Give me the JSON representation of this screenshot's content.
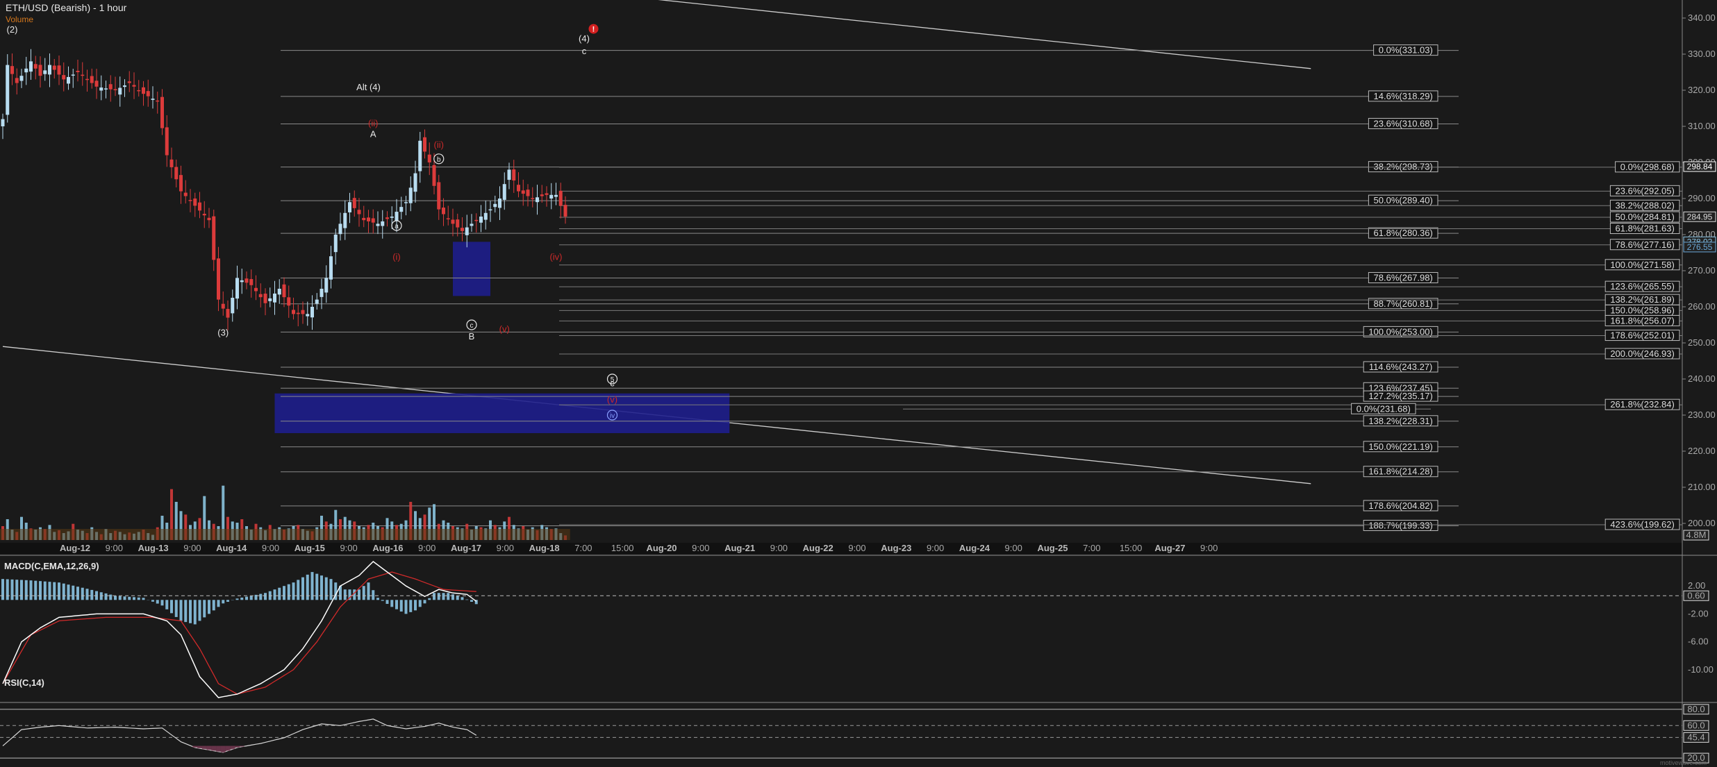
{
  "chart_data": {
    "type": "line",
    "title": "ETH/USD (Bearish) - 1 hour",
    "volume_label": "Volume",
    "volume_axis_label": "4.8M",
    "macd_title": "MACD(C,EMA,12,26,9)",
    "rsi_title": "RSI(C,14)",
    "watermark": "motivewave.com",
    "price_axis": {
      "range": [
        195,
        345
      ],
      "ticks": [
        200,
        210,
        220,
        230,
        240,
        250,
        260,
        270,
        280,
        290,
        300,
        310,
        320,
        330,
        340
      ]
    },
    "price_badges": [
      {
        "value": 298.84,
        "label": "298.84",
        "color": "#ffffff"
      },
      {
        "value": 284.95,
        "label": "284.95",
        "color": "#dddddd"
      },
      {
        "value": 278.02,
        "label": "278.02",
        "color": "#8ac6e8"
      },
      {
        "value": 276.55,
        "label": "276.55",
        "color": "#6aa8d8"
      }
    ],
    "macd_axis": {
      "range": [
        -14,
        6
      ],
      "ticks": [
        2.0,
        -2.0,
        -6.0,
        -10.0
      ],
      "tick_labels": [
        "2.00",
        "-2.00",
        "-6.00",
        "-10.00"
      ],
      "badge": "0.60",
      "badge_value": 0.6
    },
    "rsi_axis": {
      "range": [
        15,
        85
      ],
      "ticks": [
        80.0,
        60.0,
        45.4,
        20.0
      ],
      "tick_labels": [
        "80.0",
        "60.0",
        "45.4",
        "20.0"
      ],
      "dashed_levels": [
        60,
        45.4
      ]
    },
    "time_axis": {
      "labels": [
        "Aug-12",
        "9:00",
        "Aug-13",
        "9:00",
        "Aug-14",
        "9:00",
        "Aug-15",
        "9:00",
        "Aug-16",
        "9:00",
        "Aug-17",
        "9:00",
        "Aug-18",
        "7:00",
        "15:00",
        "Aug-20",
        "9:00",
        "Aug-21",
        "9:00",
        "Aug-22",
        "9:00",
        "Aug-23",
        "9:00",
        "Aug-24",
        "9:00",
        "Aug-25",
        "7:00",
        "15:00",
        "Aug-27",
        "9:00"
      ],
      "bold": [
        "Aug-12",
        "Aug-13",
        "Aug-14",
        "Aug-15",
        "Aug-16",
        "Aug-17",
        "Aug-18",
        "Aug-20",
        "Aug-21",
        "Aug-22",
        "Aug-23",
        "Aug-24",
        "Aug-25",
        "Aug-27"
      ]
    },
    "price_series": {
      "name": "ETH/USD",
      "anchors": [
        [
          0,
          312
        ],
        [
          1,
          327
        ],
        [
          3,
          322
        ],
        [
          6,
          328
        ],
        [
          8,
          324
        ],
        [
          10,
          327
        ],
        [
          13,
          323
        ],
        [
          16,
          325
        ],
        [
          20,
          321
        ],
        [
          24,
          320
        ],
        [
          27,
          322
        ],
        [
          30,
          319
        ],
        [
          33,
          317
        ],
        [
          35,
          302
        ],
        [
          38,
          292
        ],
        [
          41,
          288
        ],
        [
          44,
          284
        ],
        [
          46,
          262
        ],
        [
          48,
          257
        ],
        [
          50,
          268
        ],
        [
          53,
          266
        ],
        [
          56,
          261
        ],
        [
          59,
          265
        ],
        [
          62,
          258
        ],
        [
          65,
          258
        ],
        [
          67,
          262
        ],
        [
          69,
          268
        ],
        [
          71,
          280
        ],
        [
          74,
          289
        ],
        [
          77,
          284
        ],
        [
          80,
          283
        ],
        [
          83,
          285
        ],
        [
          86,
          289
        ],
        [
          88,
          297
        ],
        [
          89,
          306
        ],
        [
          91,
          300
        ],
        [
          93,
          287
        ],
        [
          96,
          283
        ],
        [
          98,
          281
        ],
        [
          101,
          284
        ],
        [
          104,
          287
        ],
        [
          106,
          290
        ],
        [
          108,
          298
        ],
        [
          110,
          292
        ],
        [
          113,
          290
        ],
        [
          116,
          291
        ],
        [
          118,
          291
        ],
        [
          120,
          285
        ]
      ]
    },
    "volume": [
      120,
      180,
      90,
      70,
      200,
      150,
      100,
      90,
      110,
      95,
      130,
      70,
      85,
      60,
      75,
      140,
      90,
      80,
      60,
      110,
      70,
      50,
      95,
      60,
      80,
      70,
      50,
      65,
      55,
      70,
      90,
      60,
      45,
      110,
      210,
      150,
      440,
      330,
      250,
      220,
      130,
      160,
      190,
      380,
      170,
      140,
      120,
      470,
      200,
      160,
      150,
      180,
      120,
      90,
      140,
      110,
      85,
      130,
      95,
      110,
      90,
      100,
      120,
      130,
      95,
      80,
      75,
      110,
      210,
      160,
      140,
      260,
      180,
      200,
      170,
      160,
      120,
      110,
      130,
      150,
      120,
      110,
      190,
      160,
      130,
      140,
      170,
      330,
      250,
      190,
      220,
      280,
      310,
      140,
      170,
      150,
      120,
      110,
      100,
      140,
      90,
      120,
      110,
      100,
      170,
      130,
      110,
      160,
      200,
      130,
      100,
      120,
      90,
      110,
      85,
      130,
      110,
      95,
      100,
      60,
      40
    ],
    "fib_left": [
      {
        "label": "0.0%(331.03)",
        "value": 331.03
      },
      {
        "label": "14.6%(318.29)",
        "value": 318.29
      },
      {
        "label": "23.6%(310.68)",
        "value": 310.68
      },
      {
        "label": "38.2%(298.73)",
        "value": 298.73
      },
      {
        "label": "50.0%(289.40)",
        "value": 289.4
      },
      {
        "label": "61.8%(280.36)",
        "value": 280.36
      },
      {
        "label": "78.6%(267.98)",
        "value": 267.98
      },
      {
        "label": "88.7%(260.81)",
        "value": 260.81
      },
      {
        "label": "100.0%(253.00)",
        "value": 253.0
      },
      {
        "label": "114.6%(243.27)",
        "value": 243.27
      },
      {
        "label": "123.6%(237.45)",
        "value": 237.45
      },
      {
        "label": "127.2%(235.17)",
        "value": 235.17
      },
      {
        "label": "138.2%(228.31)",
        "value": 228.31
      },
      {
        "label": "150.0%(221.19)",
        "value": 221.19
      },
      {
        "label": "161.8%(214.28)",
        "value": 214.28
      },
      {
        "label": "178.6%(204.82)",
        "value": 204.82
      },
      {
        "label": "188.7%(199.33)",
        "value": 199.33
      }
    ],
    "fib_right": [
      {
        "label": "0.0%(298.68)",
        "value": 298.68
      },
      {
        "label": "23.6%(292.05)",
        "value": 292.05
      },
      {
        "label": "38.2%(288.02)",
        "value": 288.02
      },
      {
        "label": "50.0%(284.81)",
        "value": 284.81
      },
      {
        "label": "61.8%(281.63)",
        "value": 281.63
      },
      {
        "label": "78.6%(277.16)",
        "value": 277.16
      },
      {
        "label": "100.0%(271.58)",
        "value": 271.58
      },
      {
        "label": "123.6%(265.55)",
        "value": 265.55
      },
      {
        "label": "138.2%(261.89)",
        "value": 261.89
      },
      {
        "label": "150.0%(258.96)",
        "value": 258.96
      },
      {
        "label": "161.8%(256.07)",
        "value": 256.07
      },
      {
        "label": "178.6%(252.01)",
        "value": 252.01
      },
      {
        "label": "200.0%(246.93)",
        "value": 246.93
      },
      {
        "label": "261.8%(232.84)",
        "value": 232.84
      },
      {
        "label": "423.6%(199.62)",
        "value": 199.62
      }
    ],
    "fib_mid": {
      "label": "0.0%(231.68)",
      "value": 231.68
    },
    "wave_labels": [
      {
        "text": "(2)",
        "bar": 2,
        "price": 336,
        "color": "white"
      },
      {
        "text": "(3)",
        "bar": 47,
        "price": 252,
        "color": "white"
      },
      {
        "text": "Alt (4)",
        "bar": 78,
        "price": 320,
        "color": "white"
      },
      {
        "text": "A",
        "bar": 79,
        "price": 307,
        "color": "white"
      },
      {
        "text": "(4)",
        "bar": 124,
        "price": 333.5,
        "color": "white"
      },
      {
        "text": "c",
        "bar": 124,
        "price": 330,
        "color": "white"
      },
      {
        "text": "B",
        "bar": 100,
        "price": 251,
        "color": "white"
      },
      {
        "text": "c",
        "bar": 130,
        "price": 238,
        "color": "white"
      },
      {
        "text": "(i)",
        "bar": 84,
        "price": 273,
        "color": "red"
      },
      {
        "text": "(ii)",
        "bar": 79,
        "price": 310,
        "color": "red"
      },
      {
        "text": "(ii)",
        "bar": 93,
        "price": 304,
        "color": "red"
      },
      {
        "text": "(iv)",
        "bar": 118,
        "price": 273,
        "color": "red"
      },
      {
        "text": "(v)",
        "bar": 107,
        "price": 253,
        "color": "red"
      },
      {
        "text": "(v)",
        "bar": 130,
        "price": 233.5,
        "color": "red"
      }
    ],
    "circled_labels": [
      {
        "text": "a",
        "bar": 84,
        "price": 282.5,
        "color": "white"
      },
      {
        "text": "b",
        "bar": 93,
        "price": 301,
        "color": "white"
      },
      {
        "text": "c",
        "bar": 100,
        "price": 255,
        "color": "white"
      },
      {
        "text": "5",
        "bar": 130,
        "price": 240,
        "color": "white"
      },
      {
        "text": "iv",
        "bar": 130,
        "price": 230,
        "color": "#8aa0ff"
      }
    ],
    "alert_marker": {
      "bar": 126,
      "price": 337
    },
    "target_boxes": [
      {
        "bar_start": 96,
        "bar_end": 104,
        "price_top": 278,
        "price_bottom": 263
      },
      {
        "bar_start": 58,
        "bar_end": 155,
        "price_top": 236,
        "price_bottom": 225
      }
    ],
    "trendlines": [
      {
        "from": [
          137,
          345.5
        ],
        "to": [
          279,
          326
        ]
      },
      {
        "from": [
          0,
          249
        ],
        "to": [
          279,
          211
        ]
      }
    ],
    "macd": {
      "macd_anchors": [
        [
          0,
          -12
        ],
        [
          4,
          -6
        ],
        [
          8,
          -4
        ],
        [
          12,
          -2.5
        ],
        [
          20,
          -2
        ],
        [
          30,
          -2
        ],
        [
          35,
          -3
        ],
        [
          38,
          -5
        ],
        [
          42,
          -11
        ],
        [
          46,
          -14
        ],
        [
          50,
          -13.5
        ],
        [
          55,
          -12
        ],
        [
          60,
          -10
        ],
        [
          64,
          -7
        ],
        [
          68,
          -3
        ],
        [
          72,
          2
        ],
        [
          76,
          3.5
        ],
        [
          79,
          5.5
        ],
        [
          82,
          4
        ],
        [
          86,
          2
        ],
        [
          90,
          0.5
        ],
        [
          93,
          1.5
        ],
        [
          96,
          1
        ],
        [
          99,
          0.8
        ],
        [
          101,
          -0.2
        ]
      ],
      "signal_anchors": [
        [
          0,
          -12
        ],
        [
          6,
          -5
        ],
        [
          12,
          -3
        ],
        [
          22,
          -2.5
        ],
        [
          32,
          -2.5
        ],
        [
          38,
          -3
        ],
        [
          42,
          -7
        ],
        [
          46,
          -12
        ],
        [
          50,
          -13.5
        ],
        [
          56,
          -12.5
        ],
        [
          62,
          -10
        ],
        [
          67,
          -6
        ],
        [
          72,
          -1
        ],
        [
          78,
          3
        ],
        [
          83,
          4
        ],
        [
          88,
          3
        ],
        [
          94,
          1.5
        ],
        [
          101,
          1.2
        ]
      ],
      "hist_anchors": [
        [
          0,
          3
        ],
        [
          6,
          2.8
        ],
        [
          12,
          2.5
        ],
        [
          18,
          1.6
        ],
        [
          24,
          0.6
        ],
        [
          30,
          0.3
        ],
        [
          34,
          -0.8
        ],
        [
          38,
          -3
        ],
        [
          41,
          -3.5
        ],
        [
          44,
          -2
        ],
        [
          47,
          -0.5
        ],
        [
          50,
          0.2
        ],
        [
          56,
          1
        ],
        [
          62,
          2.5
        ],
        [
          66,
          4
        ],
        [
          70,
          3
        ],
        [
          73,
          1.5
        ],
        [
          76,
          1.5
        ],
        [
          78,
          2.5
        ],
        [
          80,
          0.3
        ],
        [
          83,
          -1
        ],
        [
          86,
          -2
        ],
        [
          88,
          -1.5
        ],
        [
          90,
          -0.5
        ],
        [
          92,
          1
        ],
        [
          95,
          1
        ],
        [
          98,
          0.4
        ],
        [
          101,
          -0.6
        ]
      ]
    },
    "rsi": {
      "anchors": [
        [
          0,
          35
        ],
        [
          4,
          55
        ],
        [
          8,
          58
        ],
        [
          12,
          60
        ],
        [
          18,
          57
        ],
        [
          24,
          58
        ],
        [
          30,
          56
        ],
        [
          34,
          57
        ],
        [
          38,
          40
        ],
        [
          41,
          33
        ],
        [
          44,
          30
        ],
        [
          47,
          27
        ],
        [
          50,
          33
        ],
        [
          55,
          38
        ],
        [
          60,
          45
        ],
        [
          64,
          55
        ],
        [
          68,
          62
        ],
        [
          72,
          60
        ],
        [
          76,
          65
        ],
        [
          79,
          68
        ],
        [
          82,
          60
        ],
        [
          86,
          56
        ],
        [
          90,
          59
        ],
        [
          93,
          63
        ],
        [
          96,
          58
        ],
        [
          99,
          55
        ],
        [
          101,
          48
        ]
      ]
    }
  }
}
